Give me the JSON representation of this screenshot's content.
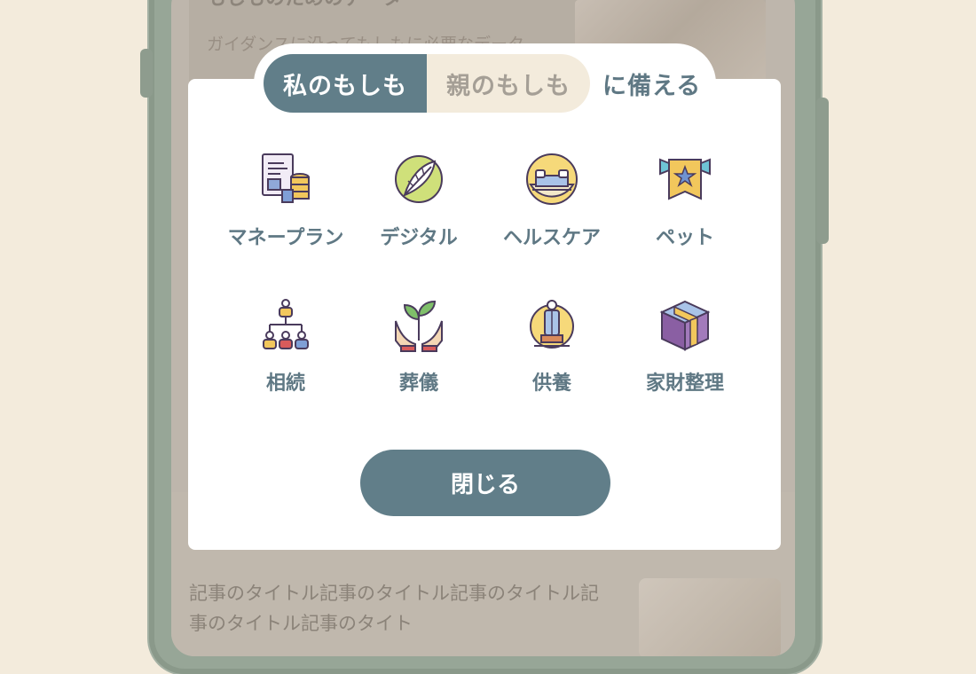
{
  "background": {
    "heading": "もしものためのデータ",
    "subtext": "ガイダンスに沿ってもしもに必要なデータ",
    "article_title": "記事のタイトル記事のタイトル記事のタイトル記事のタイトル記事のタイト"
  },
  "tabs": [
    {
      "label": "私のもしも",
      "active": true
    },
    {
      "label": "親のもしも",
      "active": false
    }
  ],
  "tab_suffix": "に備える",
  "categories": [
    {
      "label": "マネープラン",
      "icon": "money-plan-icon"
    },
    {
      "label": "デジタル",
      "icon": "digital-leaf-icon"
    },
    {
      "label": "ヘルスケア",
      "icon": "healthcare-bed-icon"
    },
    {
      "label": "ペット",
      "icon": "pet-ribbon-icon"
    },
    {
      "label": "相続",
      "icon": "inheritance-family-tree-icon"
    },
    {
      "label": "葬儀",
      "icon": "funeral-plant-hands-icon"
    },
    {
      "label": "供養",
      "icon": "memorial-statue-icon"
    },
    {
      "label": "家財整理",
      "icon": "household-box-icon"
    }
  ],
  "close_label": "閉じる",
  "colors": {
    "primary": "#617e89",
    "tab_inactive_bg": "#f3ebdc",
    "page_bg": "#f3ebdc",
    "label_text": "#5f7884"
  }
}
